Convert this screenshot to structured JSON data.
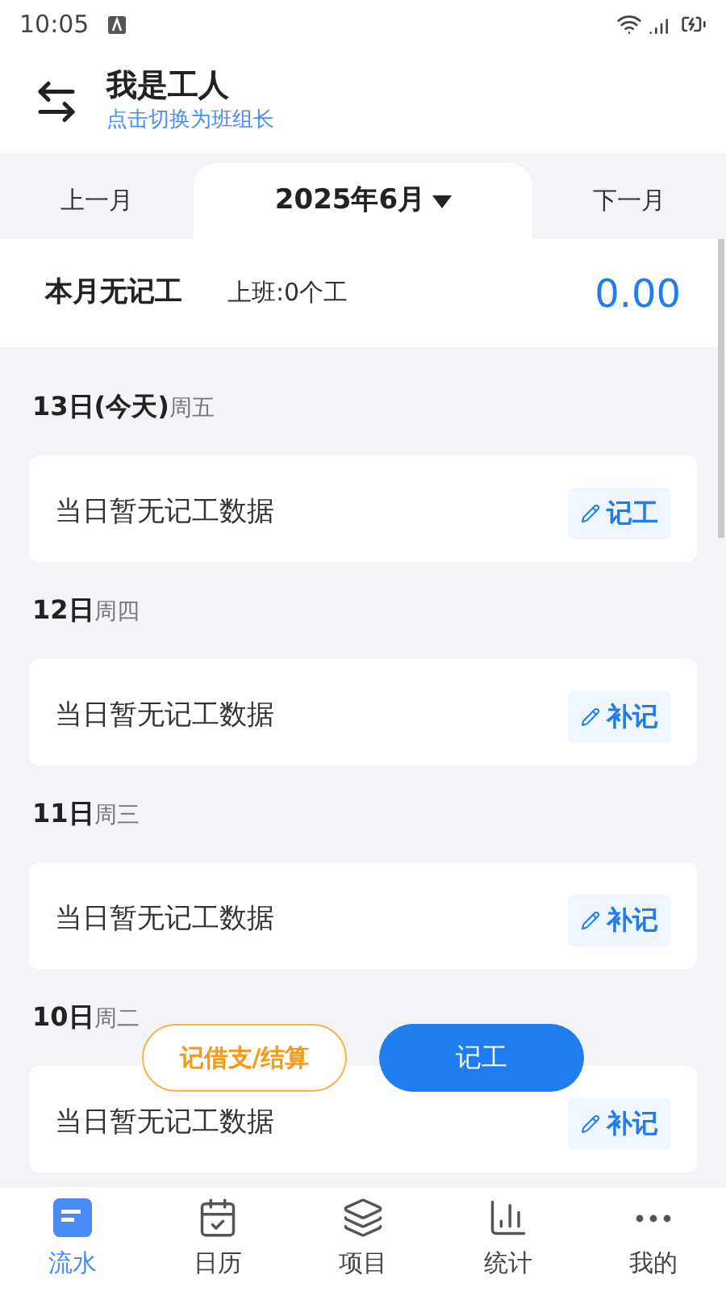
{
  "status_bar": {
    "time": "10:05"
  },
  "header": {
    "title": "我是工人",
    "subtitle": "点击切换为班组长"
  },
  "month_tabs": [
    {
      "label": "上一月",
      "selected": false
    },
    {
      "label": "2025年6月",
      "selected": true
    },
    {
      "label": "下一月",
      "selected": false
    }
  ],
  "summary": {
    "title": "本月无记工",
    "detail": "上班:0个工",
    "amount": "0.00"
  },
  "days": [
    {
      "date": "13日(今天)",
      "weekday": "周五",
      "text": "当日暂无记工数据",
      "action": "记工"
    },
    {
      "date": "12日",
      "weekday": "周四",
      "text": "当日暂无记工数据",
      "action": "补记"
    },
    {
      "date": "11日",
      "weekday": "周三",
      "text": "当日暂无记工数据",
      "action": "补记"
    },
    {
      "date": "10日",
      "weekday": "周二",
      "text": "当日暂无记工数据",
      "action": "补记"
    }
  ],
  "floating_buttons": [
    {
      "label": "记借支/结算",
      "kind": "outline"
    },
    {
      "label": "记工",
      "kind": "primary"
    }
  ],
  "bottom_nav": [
    {
      "label": "流水",
      "kind": "list",
      "selected": true
    },
    {
      "label": "日历",
      "kind": "calendar",
      "selected": false
    },
    {
      "label": "项目",
      "kind": "layers",
      "selected": false
    },
    {
      "label": "统计",
      "kind": "chart",
      "selected": false
    },
    {
      "label": "我的",
      "kind": "more",
      "selected": false
    }
  ]
}
